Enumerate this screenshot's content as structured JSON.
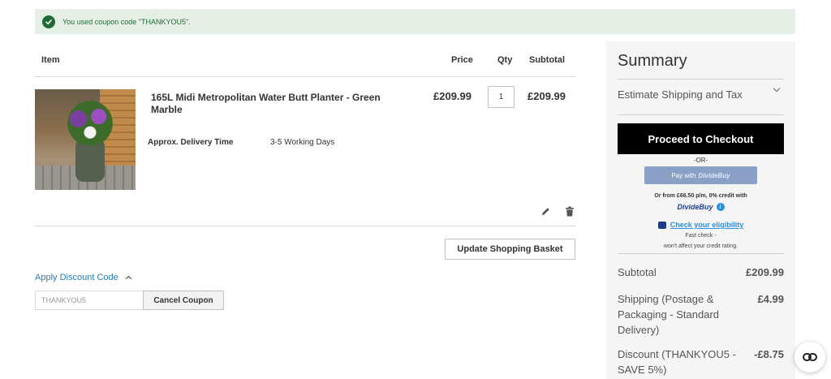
{
  "notice": {
    "message": "You used coupon code \"THANKYOU5\".",
    "color": "#1e6b35",
    "icon": "check-circle-icon"
  },
  "cart": {
    "headers": {
      "item": "Item",
      "price": "Price",
      "qty": "Qty",
      "subtotal": "Subtotal"
    },
    "item": {
      "name": "165L Midi Metropolitan Water Butt Planter - Green Marble",
      "price": "£209.99",
      "qty": "1",
      "subtotal": "£209.99",
      "delivery_label": "Approx. Delivery Time",
      "delivery_value": "3-5 Working Days"
    },
    "update_label": "Update Shopping Basket"
  },
  "discount": {
    "toggle_label": "Apply Discount Code",
    "code_value": "THANKYOU5",
    "cancel_label": "Cancel Coupon"
  },
  "summary": {
    "title": "Summary",
    "estimate_label": "Estimate Shipping and Tax",
    "checkout_label": "Proceed to Checkout",
    "or_label": "-OR-",
    "pay_with": "Pay with",
    "pay_brand": "DivideBuy",
    "credit_text": "Or from £66.50 p/m, 0% credit with",
    "db_logo": "DivideBuy",
    "info_symbol": "i",
    "eligibility_link": "Check your eligibility",
    "fast_check": "Fast check -",
    "credit_rating_note": "won't affect your credit rating.",
    "rows": [
      {
        "label": "Subtotal",
        "value": "£209.99"
      },
      {
        "label": "Shipping (Postage & Packaging - Standard Delivery)",
        "value": "£4.99"
      },
      {
        "label": "Discount (THANKYOU5 - SAVE 5%)",
        "value": "-£8.75"
      }
    ]
  },
  "colors": {
    "notice_bg": "#e5efe5",
    "link": "#2b7bb0",
    "checkout_bg": "#000000",
    "dividebuy": "#8aa0c5"
  }
}
